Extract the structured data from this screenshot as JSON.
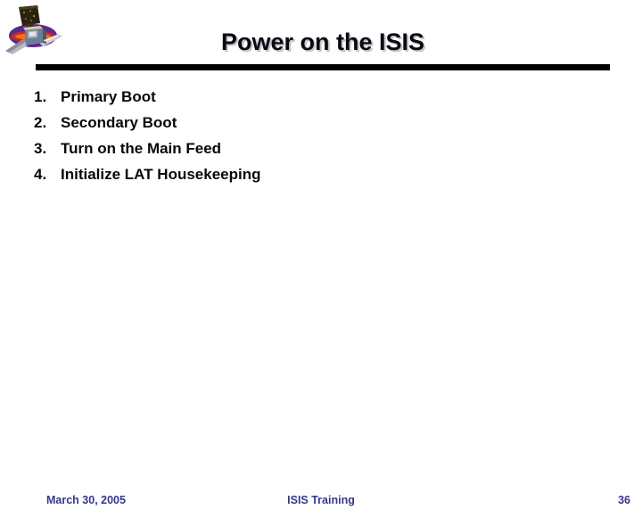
{
  "slide": {
    "title": "Power on the ISIS",
    "logo_icon": "glast-satellite-logo-icon",
    "divider_color": "#000000",
    "title_color": "#0a0a14",
    "body_text_color": "#080808",
    "footer_color": "#37378c",
    "background_color": "#ffffff"
  },
  "body": {
    "items": [
      {
        "number": "1.",
        "text": "Primary Boot"
      },
      {
        "number": "2.",
        "text": "Secondary Boot"
      },
      {
        "number": "3.",
        "text": "Turn on the Main Feed"
      },
      {
        "number": "4.",
        "text": "Initialize LAT Housekeeping"
      }
    ]
  },
  "footer": {
    "date": "March 30, 2005",
    "center": "ISIS Training",
    "page_number": "36"
  }
}
